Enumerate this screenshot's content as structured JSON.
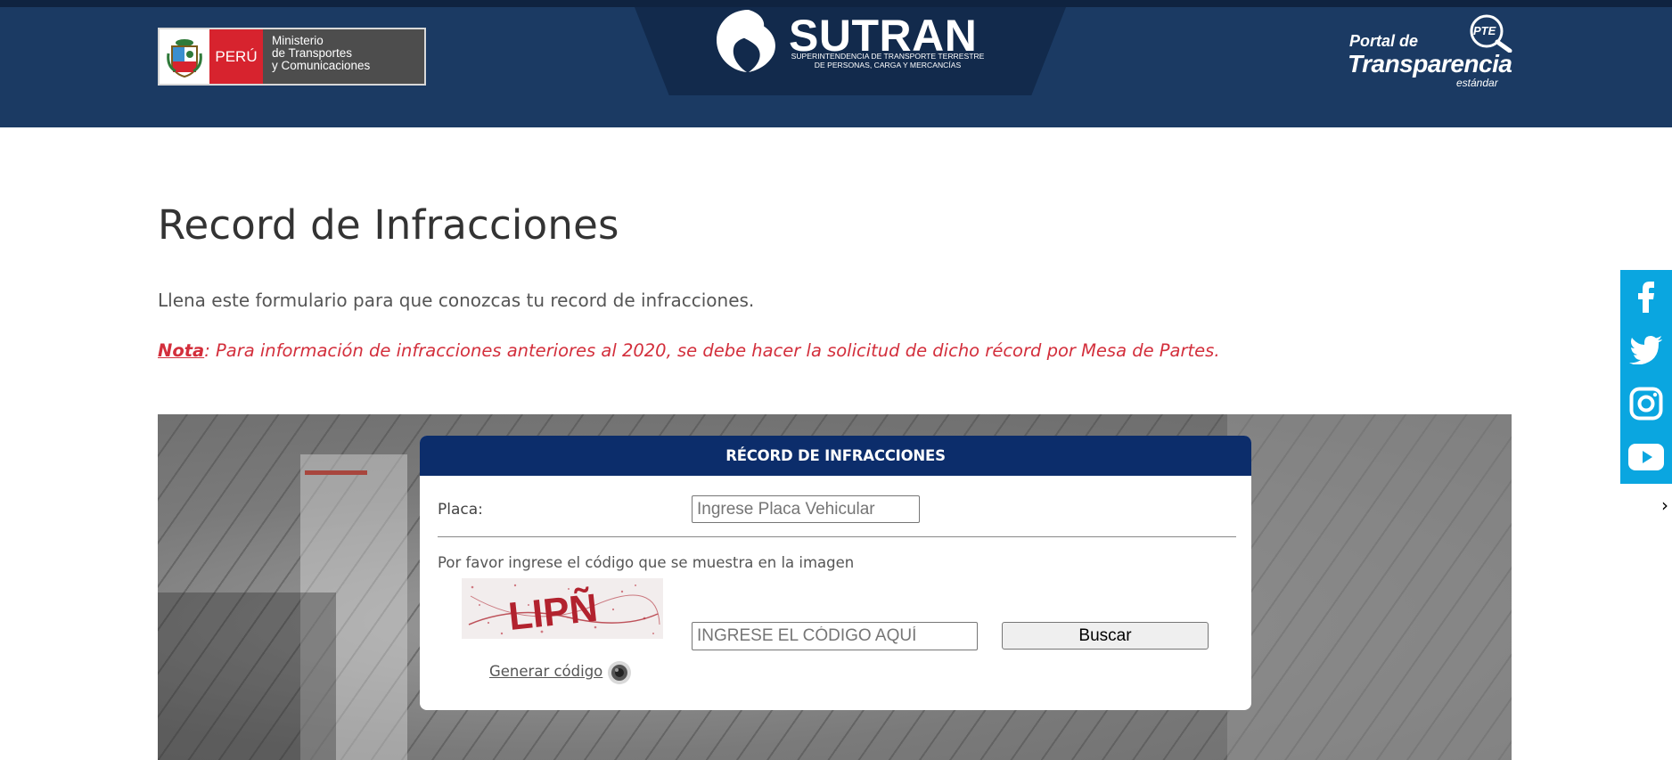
{
  "header": {
    "gov_logo": {
      "country": "PERÚ",
      "ministry_lines": [
        "Ministerio",
        "de Transportes",
        "y Comunicaciones"
      ]
    },
    "sutran": {
      "name": "SUTRAN",
      "tagline_lines": [
        "SUPERINTENDENCIA DE TRANSPORTE TERRESTRE",
        "DE PERSONAS, CARGA Y MERCANCÍAS"
      ]
    },
    "transparency": {
      "portal": "Portal de",
      "title": "Transparencia",
      "subtitle": "estándar",
      "badge": "PTE"
    }
  },
  "main": {
    "title": "Record de Infracciones",
    "intro": "Llena este formulario para que conozcas tu record de infracciones.",
    "note_label": "Nota",
    "note_text": " Para información de infracciones anteriores al 2020, se debe hacer la solicitud de dicho récord por Mesa de Partes."
  },
  "form": {
    "heading": "RÉCORD DE INFRACCIONES",
    "placa_label": "Placa:",
    "placa_placeholder": "Ingrese Placa Vehicular",
    "placa_value": "",
    "captcha_instruction": "Por favor ingrese el código que se muestra en la imagen",
    "captcha_text": "LIPÑ",
    "code_placeholder": "INGRESE EL CÓDIGO AQUÍ",
    "code_value": "",
    "search_button": "Buscar",
    "generate_link": "Generar código"
  },
  "social": [
    {
      "name": "facebook-icon",
      "label": "Facebook"
    },
    {
      "name": "twitter-icon",
      "label": "Twitter"
    },
    {
      "name": "instagram-icon",
      "label": "Instagram"
    },
    {
      "name": "youtube-icon",
      "label": "YouTube"
    }
  ],
  "colors": {
    "header_bg": "#1b3a63",
    "form_header_bg": "#0c2d6b",
    "note_red": "#d32f3c",
    "social_bg": "#0aa6e0"
  }
}
